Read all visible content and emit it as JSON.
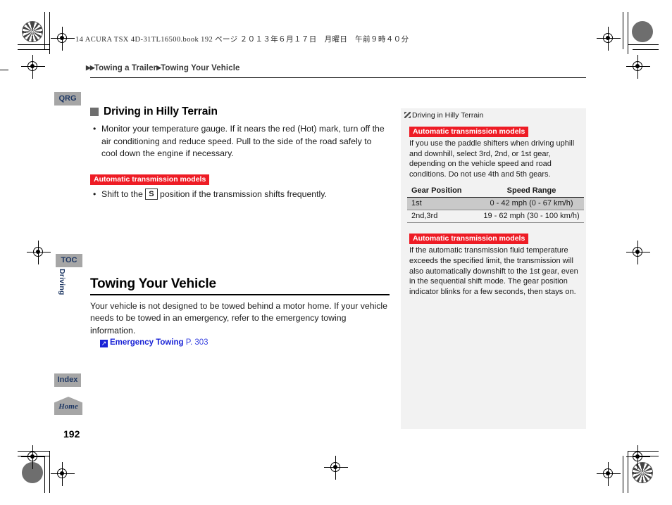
{
  "page": {
    "file_stamp": "14 ACURA TSX 4D-31TL16500.book  192 ページ  ２０１３年６月１７日　月曜日　午前９時４０分",
    "page_number": "192",
    "section_tab": "Driving"
  },
  "breadcrumb": {
    "arrow": "▶",
    "level1": "Towing a Trailer",
    "level2": "Towing Your Vehicle"
  },
  "nav_chips": {
    "qrg": "QRG",
    "toc": "TOC",
    "index": "Index",
    "home": "Home"
  },
  "main": {
    "heading2": "Driving in Hilly Terrain",
    "bullet1": "Monitor your temperature gauge. If it nears the red (Hot) mark, turn off the air conditioning and reduce speed. Pull to the side of the road safely to cool down the engine if necessary.",
    "at_tag": "Automatic transmission models",
    "bullet2_pre": "Shift to the",
    "bullet2_gear": "S",
    "bullet2_post": "position if the transmission shifts frequently.",
    "heading1": "Towing Your Vehicle",
    "paragraph": "Your vehicle is not designed to be towed behind a motor home. If your vehicle needs to be towed in an emergency, refer to the emergency towing information.",
    "xref_glyph": "↗",
    "xref_label": "Emergency Towing",
    "xref_page": "P. 303"
  },
  "sidebar": {
    "title": "Driving in Hilly Terrain",
    "note1_tag": "Automatic transmission models",
    "note1_text": "If you use the paddle shifters when driving uphill and downhill, select 3rd, 2nd, or 1st gear, depending on the vehicle speed and road conditions. Do not use 4th and 5th gears.",
    "table": {
      "headers": [
        "Gear Position",
        "Speed Range"
      ],
      "rows": [
        {
          "gear": "1st",
          "speed": "0 - 42 mph (0 - 67 km/h)",
          "shaded": true
        },
        {
          "gear": "2nd,3rd",
          "speed": "19 - 62 mph (30 - 100 km/h)",
          "shaded": false
        }
      ]
    },
    "note2_tag": "Automatic transmission models",
    "note2_text": "If the automatic transmission fluid temperature exceeds the specified limit, the transmission will also automatically downshift to the 1st gear, even in the sequential shift mode. The gear position indicator blinks for a few seconds, then stays on."
  },
  "colors": {
    "red_tag": "#ee1c25",
    "chip_gray": "#a6a6a6",
    "chip_text": "#1f3864",
    "sidebar_bg": "#f2f2f2",
    "table_shade": "#c9c9c9",
    "link_blue": "#1a23d6"
  }
}
